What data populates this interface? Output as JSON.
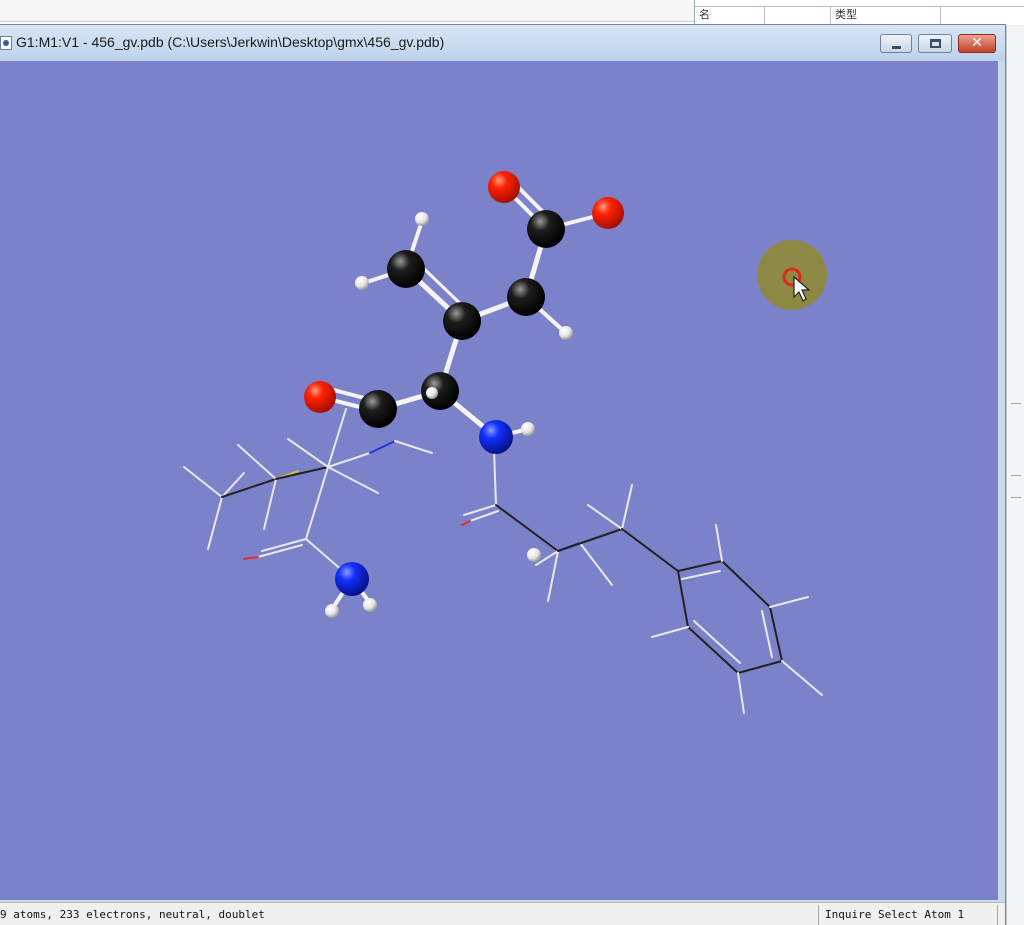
{
  "background_app": {
    "cells": [
      "名",
      "",
      "类型",
      ""
    ]
  },
  "window": {
    "title": "G1:M1:V1 - 456_gv.pdb (C:\\Users\\Jerkwin\\Desktop\\gmx\\456_gv.pdb)",
    "buttons": {
      "minimize": "minimize-icon",
      "maximize": "maximize-icon",
      "close": "close-icon",
      "close_glyph": "✕"
    }
  },
  "viewport": {
    "background_color": "#7b82ca",
    "atom_colors": {
      "C": "#000000",
      "O": "#e01a00",
      "N": "#0a1ed8",
      "H": "#f2f2f2"
    },
    "cursor_highlight_color": "#8e8a3a"
  },
  "status": {
    "left": "9 atoms, 233 electrons, neutral, doublet",
    "right": "Inquire Select Atom 1"
  }
}
